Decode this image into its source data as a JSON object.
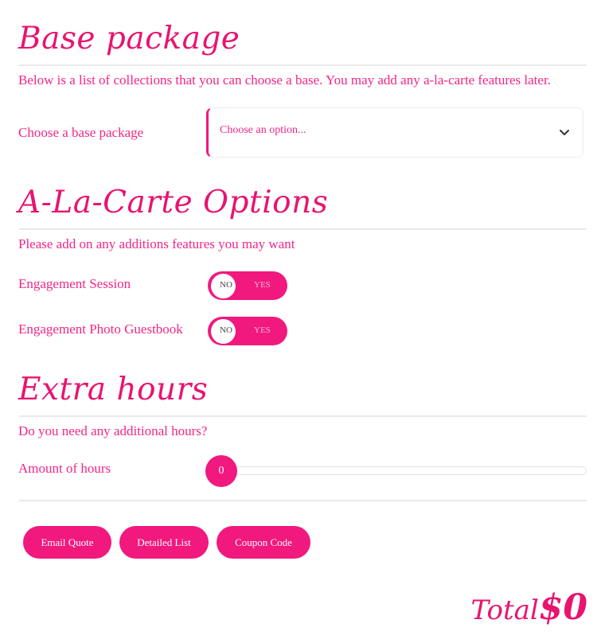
{
  "base": {
    "heading": "Base package",
    "description": "Below is a list of collections that you can choose a base. You may add any a-la-carte features later.",
    "label": "Choose a base package",
    "select_placeholder": "Choose an option..."
  },
  "alacarte": {
    "heading": "A-La-Carte Options",
    "description": "Please add on any additions features you may want",
    "options": [
      {
        "label": "Engagement Session",
        "no": "NO",
        "yes": "YES",
        "value": "NO"
      },
      {
        "label": "Engagement Photo Guestbook",
        "no": "NO",
        "yes": "YES",
        "value": "NO"
      }
    ]
  },
  "extra": {
    "heading": "Extra hours",
    "description": "Do you need any additional hours?",
    "label": "Amount of hours",
    "value": "0"
  },
  "buttons": {
    "email": "Email Quote",
    "detailed": "Detailed List",
    "coupon": "Coupon Code"
  },
  "total": {
    "label": "Total",
    "value": "$0"
  },
  "colors": {
    "accent": "#f1187e",
    "heading": "#e8146f",
    "text": "#f32587",
    "rule": "#e9e9e9"
  },
  "icons": {
    "select": "chevron-down-icon"
  }
}
